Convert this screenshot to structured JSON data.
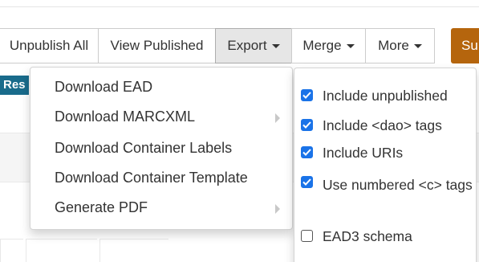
{
  "toolbar": {
    "buttons": [
      {
        "label": "Unpublish All"
      },
      {
        "label": "View Published"
      },
      {
        "label": "Export"
      },
      {
        "label": "Merge"
      },
      {
        "label": "More"
      }
    ],
    "submit_label": "Su"
  },
  "background": {
    "tab_label": "Res"
  },
  "export_menu": {
    "items": [
      {
        "label": "Download EAD"
      },
      {
        "label": "Download MARCXML"
      },
      {
        "label": "Download Container Labels"
      },
      {
        "label": "Download Container Template"
      },
      {
        "label": "Generate PDF"
      }
    ]
  },
  "ead_options": {
    "items": [
      {
        "label": "Include unpublished",
        "checked": true
      },
      {
        "label": "Include <dao> tags",
        "checked": true
      },
      {
        "label": "Include URIs",
        "checked": true
      },
      {
        "label": "Use numbered <c> tags",
        "checked": true
      },
      {
        "label": "EAD3 schema",
        "checked": false
      }
    ]
  },
  "colors": {
    "accent": "#1a73e8",
    "submit": "#b5650d",
    "tab": "#196b8b"
  }
}
